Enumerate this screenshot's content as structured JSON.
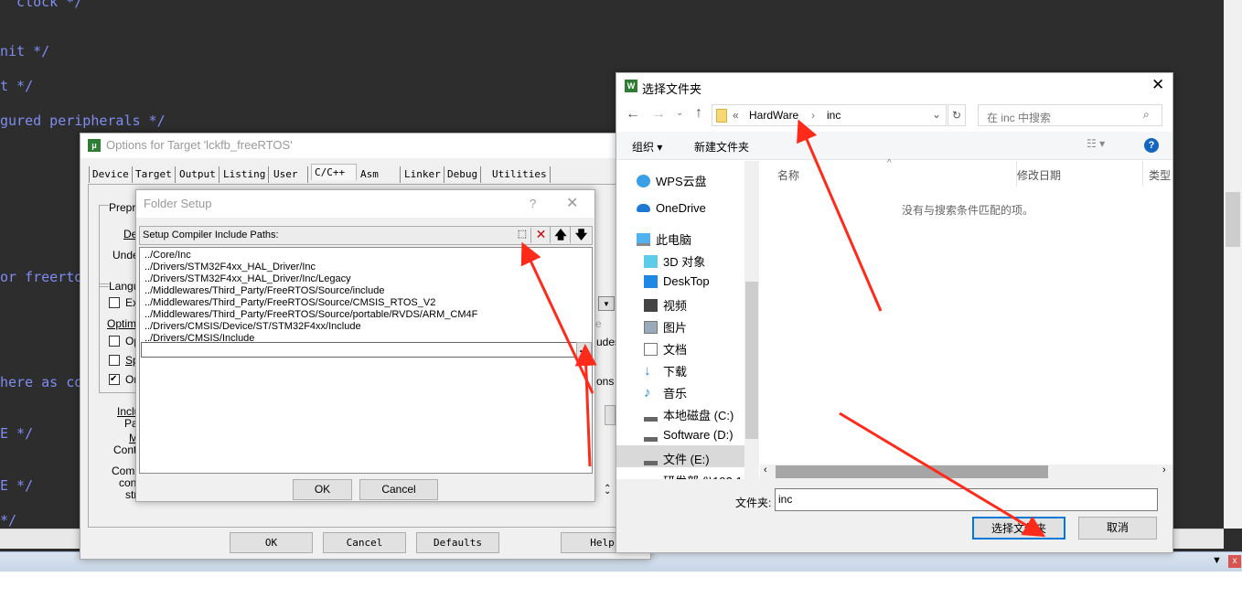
{
  "editor": {
    "code_lines": [
      "  clock */",
      "nit */",
      "t */",
      "gured peripherals */",
      "or freertos",
      "here as co",
      "E */",
      "E */",
      "*/"
    ]
  },
  "options_dialog": {
    "title": "Options for Target 'lckfb_freeRTOS'",
    "tabs": [
      "Device",
      "Target",
      "Output",
      "Listing",
      "User",
      "C/C++",
      "Asm",
      "Linker",
      "Debug",
      "Utilities"
    ],
    "active_tab": "C/C++",
    "partial_labels": {
      "preprocessor": "Prepro",
      "define": "Def",
      "undefine": "Undef",
      "language": "Langu",
      "execute": "Ex",
      "optimize": "Optimiz",
      "opt1": "Op",
      "split": "Sp",
      "one": "On",
      "include": "Inclu",
      "paths": "Pat",
      "misc": "M",
      "controls": "Contr",
      "compiler": "Comp",
      "control": "cont",
      "string": "stri",
      "includes": "udes",
      "options": "ons",
      "e": "e"
    },
    "buttons": {
      "ok": "OK",
      "cancel": "Cancel",
      "defaults": "Defaults",
      "help": "Help"
    }
  },
  "folder_setup": {
    "title": "Folder Setup",
    "help": "?",
    "header": "Setup Compiler Include Paths:",
    "paths": [
      "../Core/Inc",
      "../Drivers/STM32F4xx_HAL_Driver/Inc",
      "../Drivers/STM32F4xx_HAL_Driver/Inc/Legacy",
      "../Middlewares/Third_Party/FreeRTOS/Source/include",
      "../Middlewares/Third_Party/FreeRTOS/Source/CMSIS_RTOS_V2",
      "../Middlewares/Third_Party/FreeRTOS/Source/portable/RVDS/ARM_CM4F",
      "../Drivers/CMSIS/Device/ST/STM32F4xx/Include",
      "../Drivers/CMSIS/Include"
    ],
    "edit_value": "",
    "browse_label": "...",
    "ok": "OK",
    "cancel": "Cancel"
  },
  "file_dialog": {
    "title": "选择文件夹",
    "breadcrumb": {
      "overflow": "«",
      "parent": "HardWare",
      "sep": "›",
      "current": "inc"
    },
    "search_placeholder": "在 inc 中搜索",
    "toolbar": {
      "organize": "组织 ▾",
      "new_folder": "新建文件夹",
      "help": "?"
    },
    "nav_items": [
      "WPS云盘",
      "OneDrive",
      "此电脑",
      "3D 对象",
      "DeskTop",
      "视频",
      "图片",
      "文档",
      "下载",
      "音乐",
      "本地磁盘 (C:)",
      "Software (D:)",
      "文件 (E:)",
      "研发部 (\\\\192.1"
    ],
    "selected_nav": "文件 (E:)",
    "columns": [
      "名称",
      "修改日期",
      "类型"
    ],
    "empty_message": "没有与搜索条件匹配的项。",
    "folder_label": "文件夹:",
    "folder_value": "inc",
    "select_button": "选择文件夹",
    "cancel_button": "取消"
  },
  "annotation_color": "#ff2a1a"
}
